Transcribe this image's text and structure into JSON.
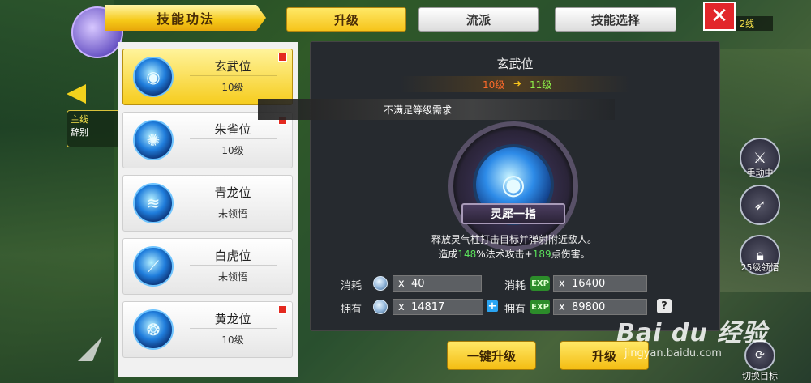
{
  "header": {
    "title": "技能功法",
    "tabs": [
      {
        "label": "升级",
        "active": true
      },
      {
        "label": "流派",
        "active": false
      },
      {
        "label": "技能选择",
        "active": false
      }
    ],
    "close_icon": "close-x-icon",
    "line_badge": "2线"
  },
  "hud_left": {
    "quest_line1": "主线",
    "quest_line2": "辞别"
  },
  "skills": [
    {
      "name": "玄武位",
      "level": "10级",
      "selected": true,
      "has_red_dot": true,
      "icon": "swirl-icon"
    },
    {
      "name": "朱雀位",
      "level": "10级",
      "selected": false,
      "has_red_dot": true,
      "icon": "burst-icon"
    },
    {
      "name": "青龙位",
      "level": "未领悟",
      "selected": false,
      "has_red_dot": false,
      "icon": "ribbon-icon"
    },
    {
      "name": "白虎位",
      "level": "未领悟",
      "selected": false,
      "has_red_dot": false,
      "icon": "claw-icon"
    },
    {
      "name": "黄龙位",
      "level": "10级",
      "selected": false,
      "has_red_dot": true,
      "icon": "dragon-icon"
    }
  ],
  "detail": {
    "title": "玄武位",
    "level_from": "10级",
    "level_to": "11级",
    "requirement_msg": "不满足等级需求",
    "skill_name": "灵犀一指",
    "desc_line1": "释放灵气柱打击目标并弹射附近敌人。",
    "desc_line2_prefix": "造成",
    "desc_pct": "148",
    "desc_line2_mid": "%法术攻击+",
    "desc_dmg": "189",
    "desc_line2_suffix": "点伤害。",
    "cost_label": "消耗",
    "own_label": "拥有",
    "x_prefix": "x",
    "cost_coin": "40",
    "own_coin": "14817",
    "cost_exp": "16400",
    "own_exp": "89800",
    "exp_icon_text": "EXP",
    "help_text": "?"
  },
  "buttons": {
    "one_click_upgrade": "一键升级",
    "upgrade": "升级"
  },
  "hud_right": {
    "manual_label": "手动中",
    "lock_label": "25级领悟",
    "switch_target_label": "切换目标"
  },
  "watermark": {
    "text": "Bai du 经验",
    "url": "jingyan.baidu.com"
  },
  "colors": {
    "accent_yellow": "#f6c41a",
    "close_red": "#e2262b",
    "level_from": "#ff6a2a",
    "level_to": "#8ef04a",
    "highlight_green": "#5be15b"
  }
}
